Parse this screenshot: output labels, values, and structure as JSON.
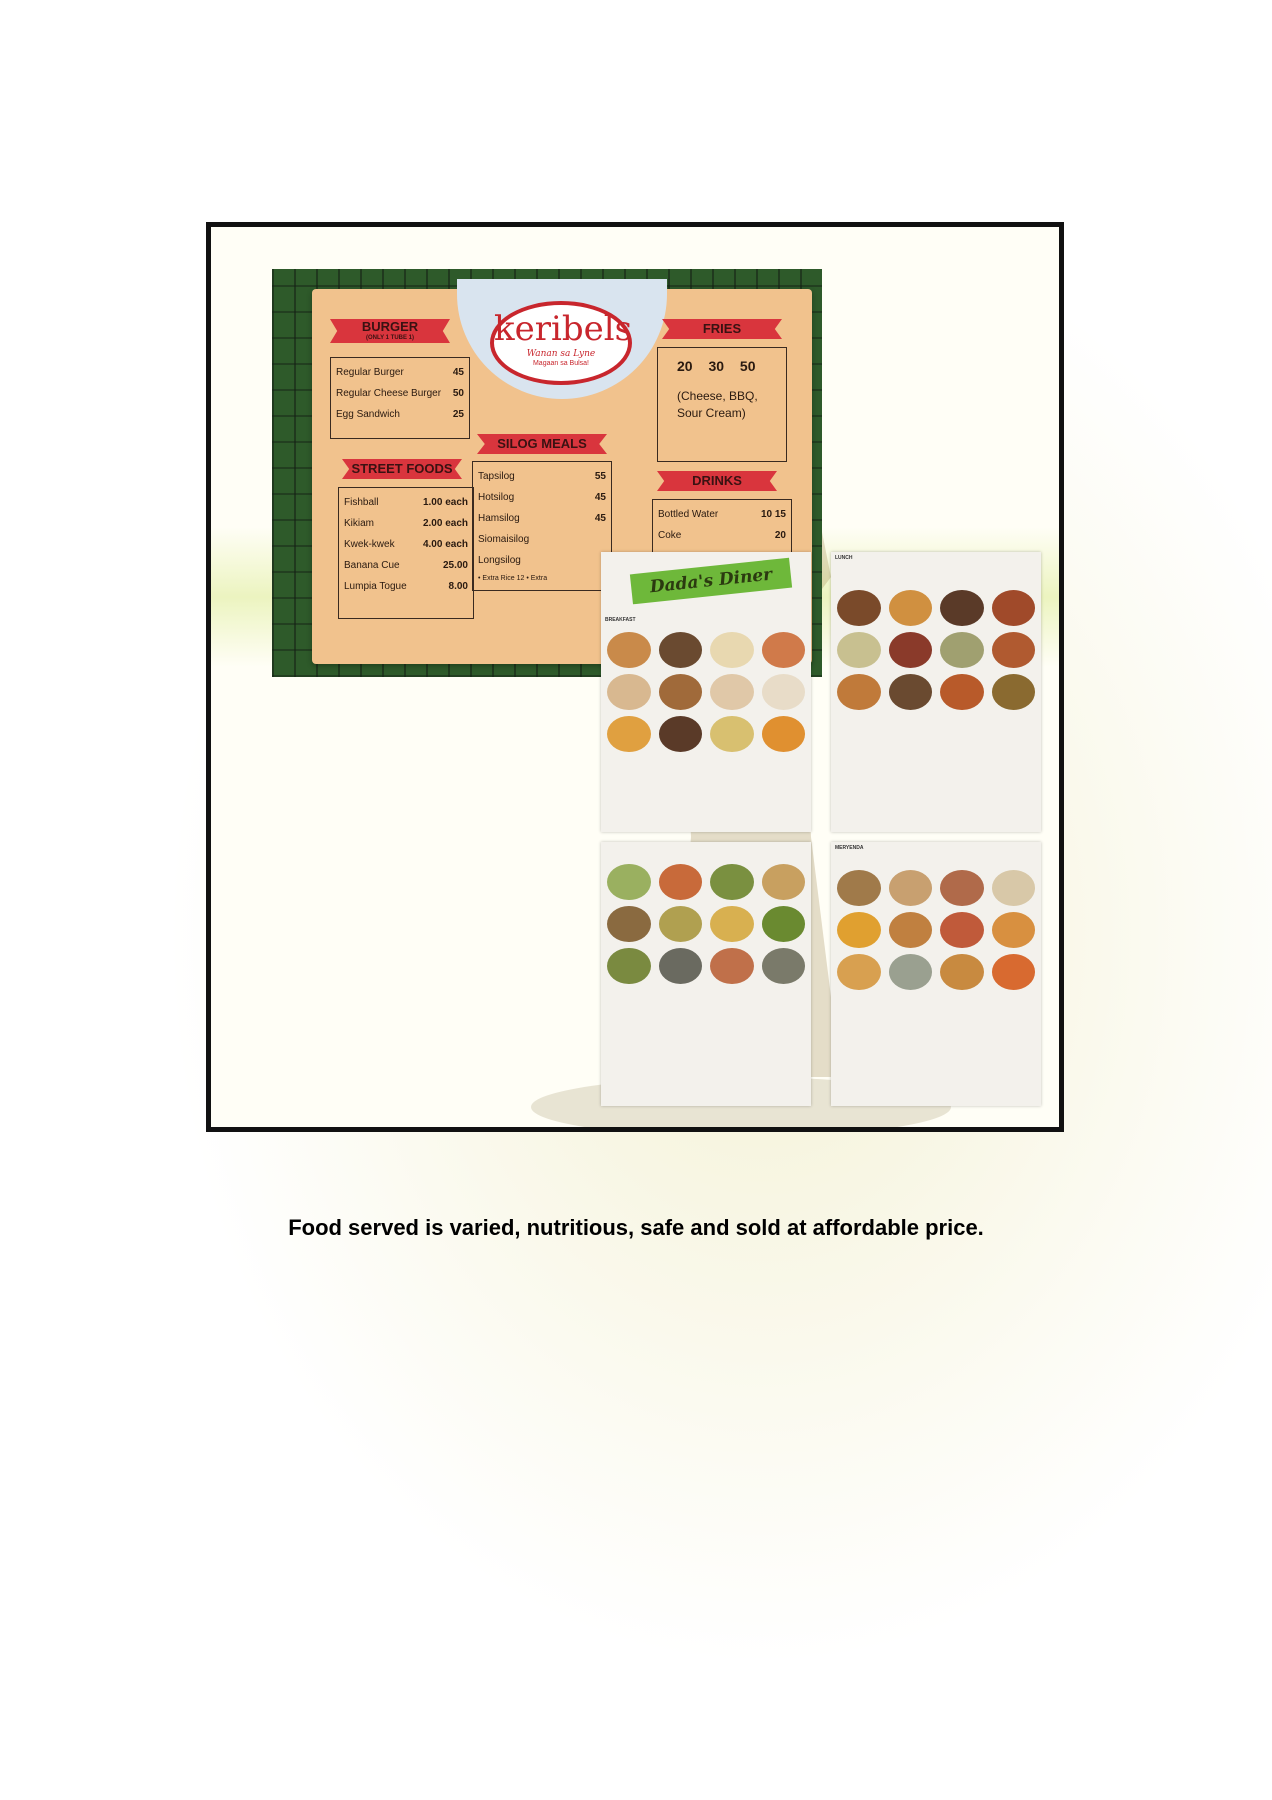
{
  "caption": "Food served is varied, nutritious, safe and sold at affordable price.",
  "banner": {
    "logo": {
      "name": "keribels",
      "tagline": "Wanan sa Lyne",
      "sub": "Magaan sa Bulsa!"
    },
    "burger": {
      "title": "BURGER",
      "subtitle": "(ONLY 1 TUBE 1)",
      "items": [
        {
          "name": "Regular Burger",
          "price": "45"
        },
        {
          "name": "Regular Cheese Burger",
          "price": "50"
        },
        {
          "name": "Egg Sandwich",
          "price": "25"
        }
      ]
    },
    "street_foods": {
      "title": "STREET FOODS",
      "items": [
        {
          "name": "Fishball",
          "price": "1.00 each"
        },
        {
          "name": "Kikiam",
          "price": "2.00 each"
        },
        {
          "name": "Kwek-kwek",
          "price": "4.00 each"
        },
        {
          "name": "Banana Cue",
          "price": "25.00"
        },
        {
          "name": "Lumpia Togue",
          "price": "8.00"
        }
      ]
    },
    "silog": {
      "title": "SILOG MEALS",
      "items": [
        {
          "name": "Tapsilog",
          "price": "55"
        },
        {
          "name": "Hotsilog",
          "price": "45"
        },
        {
          "name": "Hamsilog",
          "price": "45"
        },
        {
          "name": "Siomaisilog",
          "price": ""
        },
        {
          "name": "Longsilog",
          "price": ""
        }
      ],
      "note": "• Extra Rice 12 • Extra"
    },
    "fries": {
      "title": "FRIES",
      "prices": "20 30 50",
      "flavors": "(Cheese, BBQ, Sour Cream)"
    },
    "drinks": {
      "title": "DRINKS",
      "items": [
        {
          "name": "Bottled Water",
          "price": "10 15"
        },
        {
          "name": "Coke",
          "price": "20"
        }
      ]
    }
  },
  "dada": {
    "title": "Dada's Diner",
    "breakfast": "BREAKFAST",
    "lunch": "LUNCH",
    "meryenda": "MERYENDA"
  },
  "colors": {
    "banner_cloth": "#f1c28d",
    "ribbon": "#d9353d",
    "logo_red": "#c8262d",
    "dada_green": "#6eb83a"
  }
}
